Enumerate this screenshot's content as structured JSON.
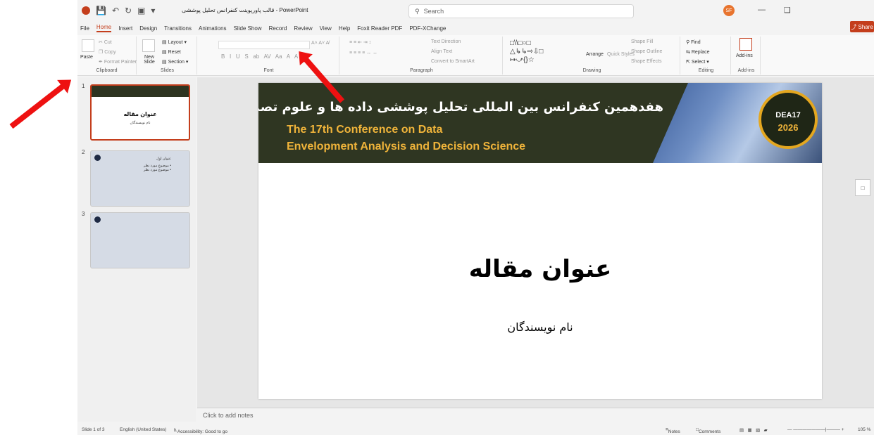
{
  "window": {
    "doc_title": "قالب پاورپوینت کنفرانس تحلیل پوششی - PowerPoint",
    "search_placeholder": "Search",
    "avatar_initials": "SF",
    "share_label": "Share"
  },
  "tabs": [
    "File",
    "Home",
    "Insert",
    "Design",
    "Transitions",
    "Animations",
    "Slide Show",
    "Record",
    "Review",
    "View",
    "Help",
    "Foxit Reader PDF",
    "PDF-XChange"
  ],
  "active_tab": "Home",
  "ribbon": {
    "clipboard": {
      "paste": "Paste",
      "cut": "Cut",
      "copy": "Copy",
      "format_painter": "Format Painter",
      "label": "Clipboard"
    },
    "slides": {
      "new_slide": "New Slide",
      "layout": "Layout",
      "reset": "Reset",
      "section": "Section",
      "label": "Slides"
    },
    "font": {
      "label": "Font"
    },
    "paragraph": {
      "text_direction": "Text Direction",
      "align_text": "Align Text",
      "convert_smartart": "Convert to SmartArt",
      "label": "Paragraph"
    },
    "drawing": {
      "arrange": "Arrange",
      "quick_styles": "Quick Styles",
      "shape_fill": "Shape Fill",
      "shape_outline": "Shape Outline",
      "shape_effects": "Shape Effects",
      "label": "Drawing"
    },
    "editing": {
      "find": "Find",
      "replace": "Replace",
      "select": "Select",
      "label": "Editing"
    },
    "addins": {
      "addins": "Add-ins",
      "label": "Add-ins"
    }
  },
  "thumbnails": [
    {
      "num": "1",
      "title": "عنوان مقاله",
      "sub": "نام نویسندگان"
    },
    {
      "num": "2",
      "title": "عنوان اول",
      "bullets": "• موضوع مورد نظر\n• موضوع مورد نظر"
    },
    {
      "num": "3"
    }
  ],
  "slide": {
    "banner_fa": "هفدهمین کنفرانس بین المللی تحلیل پوششی داده ها و علوم تصمیم",
    "banner_en_line1": "The 17th Conference on Data",
    "banner_en_line2": "Envelopment Analysis and Decision Science",
    "badge_top": "DEA17",
    "badge_year": "2026",
    "title": "عنوان مقاله",
    "subtitle": "نام نویسندگان"
  },
  "notes_placeholder": "Click to add notes",
  "status": {
    "slide_pos": "Slide 1 of 3",
    "language": "English (United States)",
    "accessibility": "Accessibility: Good to go",
    "notes": "Notes",
    "comments": "Comments",
    "zoom": "105 %"
  },
  "colors": {
    "accent": "#c43e1c",
    "banner_bg": "#2f3622",
    "banner_text_en": "#f0b43a",
    "arrow": "#ee1111"
  }
}
